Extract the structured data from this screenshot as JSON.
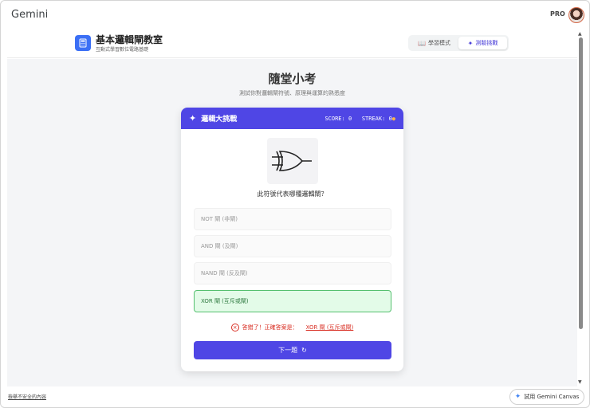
{
  "app": {
    "brand": "Gemini",
    "plan_badge": "PRO"
  },
  "header": {
    "title": "基本邏輯閘教室",
    "subtitle": "互動式學習數位電路基礎",
    "modes": [
      {
        "label": "學習模式",
        "icon": "book-icon",
        "active": false
      },
      {
        "label": "測驗挑戰",
        "icon": "brain-icon",
        "active": true
      }
    ]
  },
  "page": {
    "title": "隨堂小考",
    "subtitle": "測試你對邏輯閘符號、原理與運算的熟悉度"
  },
  "quiz": {
    "title": "邏輯大挑戰",
    "score_label": "SCORE:",
    "score": "0",
    "streak_label": "STREAK:",
    "streak": "0",
    "question": "此符號代表哪種邏輯閘？",
    "options": [
      {
        "label": "NOT 閘 (非閘)",
        "state": "disabled"
      },
      {
        "label": "AND 閘 (及閘)",
        "state": "disabled"
      },
      {
        "label": "NAND 閘 (反及閘)",
        "state": "disabled"
      },
      {
        "label": "XOR 閘 (互斥或閘)",
        "state": "correct"
      }
    ],
    "feedback": "答錯了！正確答案是：",
    "correct_answer": "XOR 閘 (互斥或閘)",
    "next_label": "下一題"
  },
  "footer": {
    "report_link": "檢舉不安全的內容",
    "canvas_button": "試用 Gemini Canvas"
  },
  "colors": {
    "accent": "#4f46e5",
    "correct_bg": "#e3fbe8",
    "correct_border": "#55c06f",
    "error": "#d93025"
  }
}
